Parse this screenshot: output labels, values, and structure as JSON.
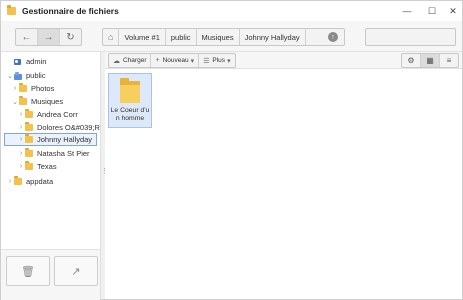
{
  "window": {
    "title": "Gestionnaire de fichiers"
  },
  "controls": {
    "minimize": "—",
    "maximize": "☐",
    "close": "✕"
  },
  "breadcrumb": [
    "Volume #1",
    "public",
    "Musiques",
    "Johnny Hallyday"
  ],
  "search": {
    "placeholder": ""
  },
  "tree": {
    "admin": "admin",
    "public": "public",
    "photos": "Photos",
    "musiques": "Musiques",
    "artists": [
      "Andrea Corr",
      "Dolores O&#039;Rio",
      "Johnny Hallyday",
      "Natasha St Pier",
      "Texas"
    ],
    "appdata": "appdata"
  },
  "content_toolbar": {
    "upload": "Charger",
    "new": "Nouveau",
    "more": "Plus"
  },
  "files": [
    {
      "name": "Le Coeur d'un homme"
    }
  ],
  "colors": {
    "accent": "#7fa7da",
    "folder": "#f2c14e",
    "selection": "#dde9f8"
  }
}
